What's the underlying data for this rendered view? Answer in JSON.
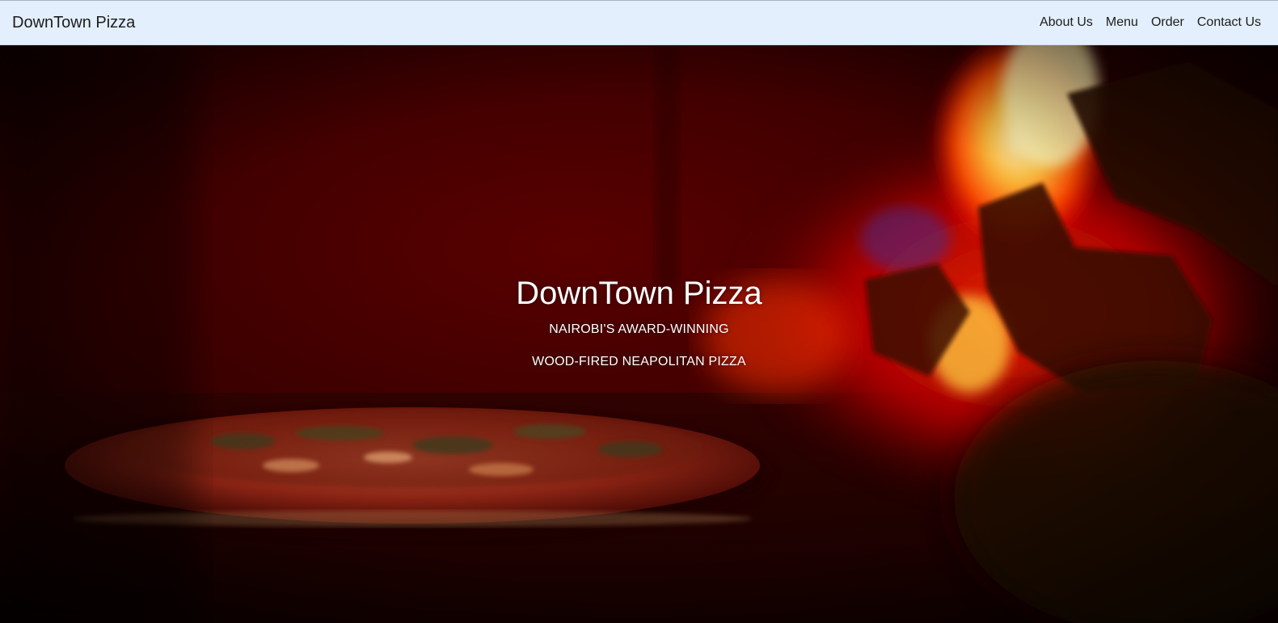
{
  "navbar": {
    "brand": "DownTown Pizza",
    "links": [
      "About Us",
      "Menu",
      "Order",
      "Contact Us"
    ]
  },
  "hero": {
    "title": "DownTown Pizza",
    "line1": "NAIROBI'S AWARD-WINNING",
    "line2": "WOOD-FIRED NEAPOLITAN PIZZA",
    "image": "wood-fired-oven-pizza-photo"
  },
  "colors": {
    "navbar_bg": "#e3effc",
    "nav_text": "#1d1d1d",
    "hero_text": "#ffffff"
  }
}
